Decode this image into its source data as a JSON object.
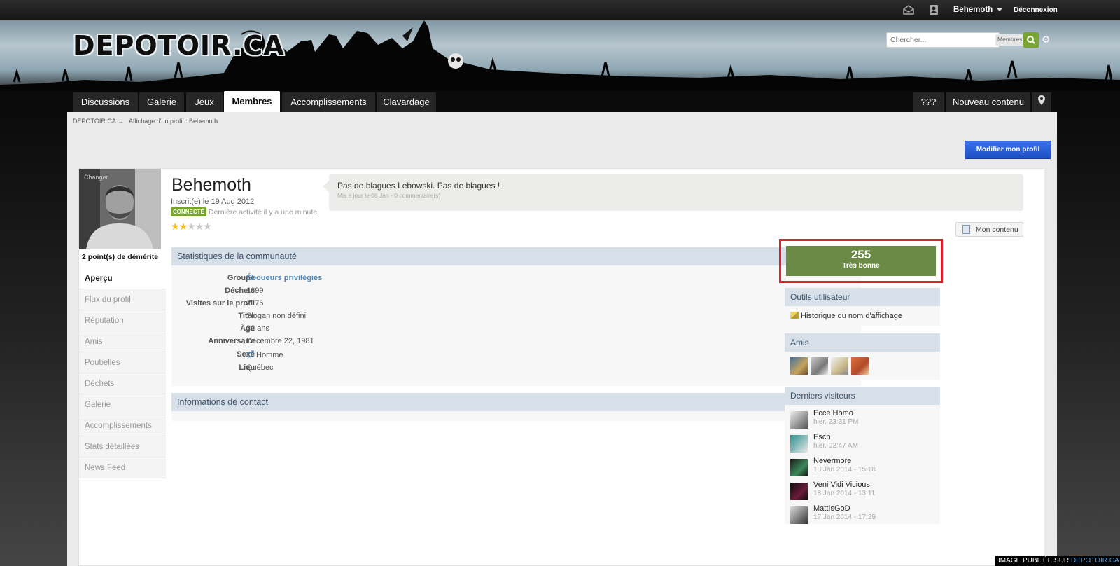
{
  "userbar": {
    "username": "Behemoth",
    "logout": "Déconnexion"
  },
  "header": {
    "logo_text": "DEPOTOIR.CA",
    "search_placeholder": "Chercher...",
    "search_scope": "Membres"
  },
  "nav": {
    "tabs": [
      "Discussions",
      "Galerie",
      "Jeux",
      "Membres",
      "Accomplissements",
      "Clavardage"
    ],
    "right": [
      "???",
      "Nouveau contenu"
    ]
  },
  "breadcrumb": {
    "root": "DEPOTOIR.CA",
    "arrow": "→",
    "current": "Affichage d'un profil : Behemoth"
  },
  "edit_profile_label": "Modifier mon profil",
  "profile": {
    "photo_change": "Changer",
    "demerit": "2 point(s) de démérite",
    "name": "Behemoth",
    "joined": "Inscrit(e) le 19 Aug 2012",
    "online_badge": "CONNECTÉ",
    "last_activity": "Dernière activité il y a une minute",
    "rating_stars": 2,
    "status_text": "Pas de blagues Lebowski. Pas de blagues !",
    "status_meta": "Mis à jour le 08 Jan - 0 commentaire(s)",
    "my_content": "Mon contenu"
  },
  "side_menu": [
    "Aperçu",
    "Flux du profil",
    "Réputation",
    "Amis",
    "Poubelles",
    "Déchets",
    "Galerie",
    "Accomplissements",
    "Stats détaillées",
    "News Feed"
  ],
  "stats": {
    "heading": "Statistiques de la communauté",
    "rows": [
      {
        "label": "Groupe",
        "value": "Éboueurs privilégiés"
      },
      {
        "label": "Déchets",
        "value": "1699"
      },
      {
        "label": "Visites sur le profil",
        "value": "2176"
      },
      {
        "label": "Titre",
        "value": "Slogan non défini"
      },
      {
        "label": "Âge",
        "value": "32 ans"
      },
      {
        "label": "Anniversaire",
        "value": "Décembre 22, 1981"
      },
      {
        "label": "Sexe",
        "value": "Homme"
      },
      {
        "label": "Lieu",
        "value": "Québec"
      }
    ]
  },
  "contact": {
    "heading": "Informations de contact"
  },
  "reputation": {
    "value": "255",
    "label": "Très bonne"
  },
  "tools": {
    "heading": "Outils utilisateur",
    "item": "Historique du nom d'affichage"
  },
  "friends": {
    "heading": "Amis"
  },
  "visitors": {
    "heading": "Derniers visiteurs",
    "items": [
      {
        "name": "Ecce Homo",
        "time": "hier, 23:31 PM"
      },
      {
        "name": "Esch",
        "time": "hier, 02:47 AM"
      },
      {
        "name": "Nevermore",
        "time": "18 Jan 2014 - 15:18"
      },
      {
        "name": "Veni Vidi Vicious",
        "time": "18 Jan 2014 - 13:11"
      },
      {
        "name": "MattIsGoD",
        "time": "17 Jan 2014 - 17:29"
      }
    ]
  },
  "watermark": {
    "prefix": "IMAGE PUBLIÉE SUR ",
    "site": "DEPOTOIR.CA"
  },
  "colors": {
    "accent_green": "#6a8a45",
    "highlight_red": "#d8232a",
    "primary_blue": "#2a60d8",
    "section_head": "#d7dfe8"
  }
}
